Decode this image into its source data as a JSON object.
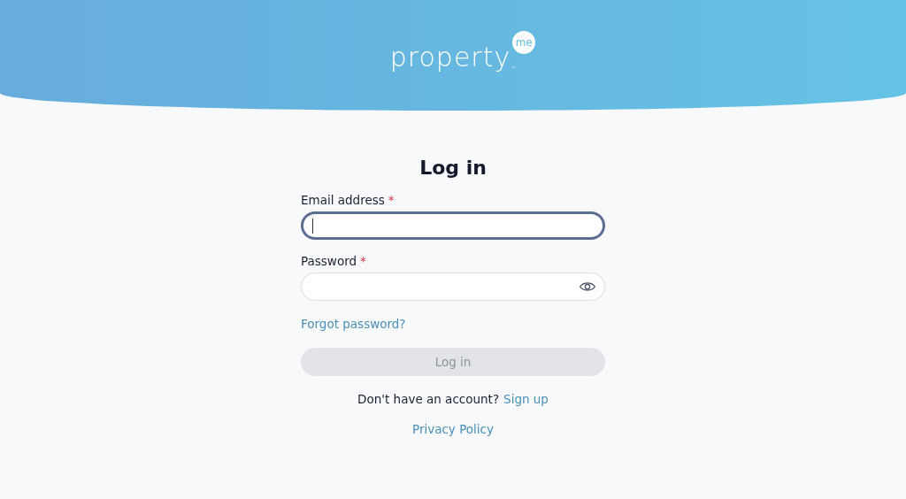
{
  "logo": {
    "wordmark": "property",
    "badge": "me",
    "trademark": "™"
  },
  "title": "Log in",
  "fields": [
    {
      "label": "Email address",
      "required_mark": "*",
      "kind": "text",
      "focused": true
    },
    {
      "label": "Password",
      "required_mark": "*",
      "kind": "password",
      "focused": false
    }
  ],
  "forgot_link": "Forgot password?",
  "submit": {
    "label": "Log in",
    "disabled": true
  },
  "signup": {
    "prompt": "Don't have an account?",
    "link": "Sign up"
  },
  "privacy_link": "Privacy Policy"
}
